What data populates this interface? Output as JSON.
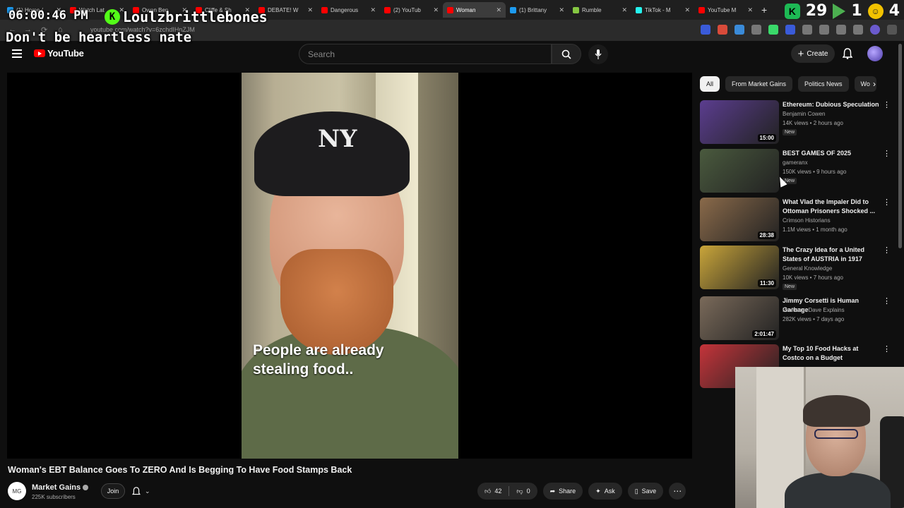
{
  "browser": {
    "tabs": [
      {
        "label": "(1) Home /",
        "color": "#1d9bf0"
      },
      {
        "label": "Watch Lat",
        "color": "#ff0000"
      },
      {
        "label": "Owen Ben",
        "color": "#ff0000"
      },
      {
        "label": "Cliffe & Sh",
        "color": "#ff0000"
      },
      {
        "label": "DEBATE! W",
        "color": "#ff0000"
      },
      {
        "label": "Dangerous",
        "color": "#ff0000"
      },
      {
        "label": "(2) YouTub",
        "color": "#ff0000"
      },
      {
        "label": "Woman",
        "color": "#ff0000"
      },
      {
        "label": "(1) Brittany",
        "color": "#1d9bf0"
      },
      {
        "label": "Rumble",
        "color": "#85c742"
      },
      {
        "label": "TikTok - M",
        "color": "#25f4ee"
      },
      {
        "label": "YouTube M",
        "color": "#ff0000"
      }
    ],
    "active_tab_index": 7,
    "new_tab": "+",
    "url": "youtube.com/watch?v=6zchdIHnZJM",
    "right_overlay": {
      "number": "29",
      "count_right": "1",
      "count_far": "4"
    }
  },
  "stream_overlay": {
    "time": "06:00:46 PM",
    "username": "Loulzbrittlebones",
    "kick_letter": "K",
    "message": "Don't be heartless nate"
  },
  "youtube": {
    "logo_text": "YouTube",
    "search_placeholder": "Search",
    "create_label": "Create"
  },
  "video": {
    "caption_line1": "People are already",
    "caption_line2": "stealing food..",
    "title": "Woman's EBT Balance Goes To ZERO And Is Begging To Have Food Stamps Back",
    "channel": "Market Gains",
    "subscribers": "225K subscribers",
    "join_label": "Join",
    "likes": "42",
    "dislikes": "0",
    "share_label": "Share",
    "ask_label": "Ask",
    "save_label": "Save"
  },
  "sidebar": {
    "chips": [
      {
        "label": "All",
        "active": true
      },
      {
        "label": "From Market Gains",
        "active": false
      },
      {
        "label": "Politics News",
        "active": false
      },
      {
        "label": "Wo",
        "active": false
      }
    ],
    "recommendations": [
      {
        "title": "Ethereum: Dubious Speculation",
        "channel": "Benjamin Cowen",
        "meta": "14K views • 2 hours ago",
        "badge": "New",
        "duration": "15:00",
        "thumb": "#5b3d8f"
      },
      {
        "title": "BEST GAMES OF 2025",
        "channel": "gameranx",
        "meta": "150K views • 9 hours ago",
        "badge": "New",
        "duration": "",
        "thumb": "#4a5a3e"
      },
      {
        "title": "What Vlad the Impaler Did to Ottoman Prisoners Shocked ...",
        "channel": "Crimson Historians",
        "meta": "1.1M views • 1 month ago",
        "badge": "",
        "duration": "28:38",
        "thumb": "#8a6a4a"
      },
      {
        "title": "The Crazy Idea for a United States of AUSTRIA in 1917",
        "channel": "General Knowledge",
        "meta": "10K views • 7 hours ago",
        "badge": "New",
        "duration": "11:30",
        "thumb": "#c9a53a"
      },
      {
        "title": "Jimmy Corsetti is Human Garbage",
        "channel": "Professor Dave Explains",
        "meta": "282K views • 7 days ago",
        "badge": "",
        "duration": "2:01:47",
        "thumb": "#7a6a5a"
      },
      {
        "title": "My Top 10 Food Hacks at Costco on a Budget",
        "channel": "",
        "meta": "",
        "badge": "",
        "duration": "",
        "thumb": "#c4343a"
      }
    ]
  }
}
